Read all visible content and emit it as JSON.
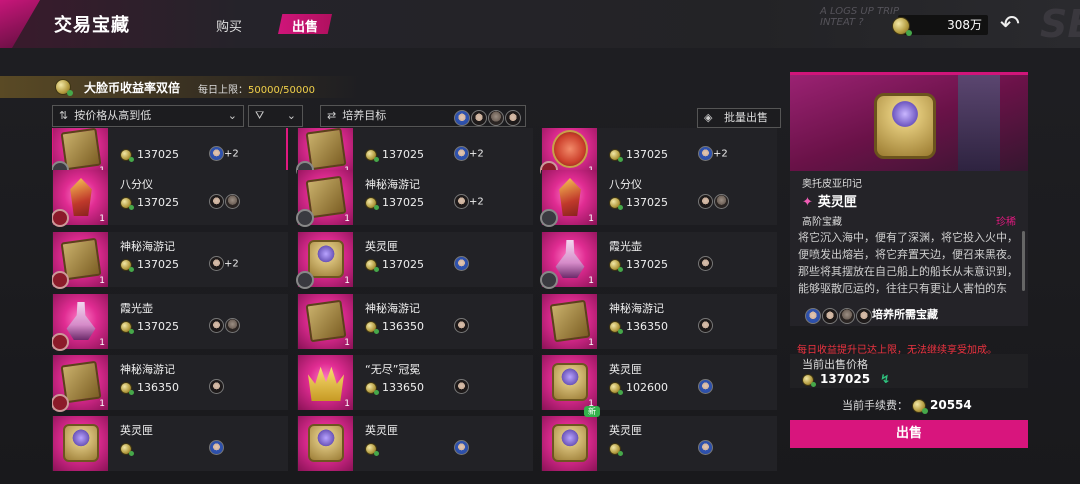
{
  "header": {
    "title": "交易宝藏",
    "tab_buy": "购买",
    "tab_sell": "出售",
    "bg_text": "A LOGS UP TRIP\nINTEAT ?",
    "currency": "308万"
  },
  "banner": {
    "title": "大脸币收益率双倍",
    "limit_label": "每日上限：",
    "limit_value": "50000/50000"
  },
  "filters": {
    "sort": "按价格从高到低",
    "train": "培养目标",
    "batch": "批量出售"
  },
  "items": [
    {
      "name": "",
      "price": "137025",
      "heads": [
        "b"
      ],
      "extra": "+2",
      "kind": "book",
      "badge": "g",
      "qty": "1",
      "selected": true
    },
    {
      "name": "",
      "price": "137025",
      "heads": [
        "b"
      ],
      "extra": "+2",
      "kind": "book",
      "badge": "g",
      "qty": "1"
    },
    {
      "name": "",
      "price": "137025",
      "heads": [
        "b"
      ],
      "extra": "+2",
      "kind": "cup",
      "badge": "r",
      "qty": "1"
    },
    {
      "name": "八分仪",
      "price": "137025",
      "heads": [
        "k",
        "a"
      ],
      "extra": "",
      "kind": "oct",
      "badge": "r",
      "qty": "1"
    },
    {
      "name": "神秘海游记",
      "price": "137025",
      "heads": [
        "k"
      ],
      "extra": "+2",
      "kind": "book",
      "badge": "g",
      "qty": "1"
    },
    {
      "name": "八分仪",
      "price": "137025",
      "heads": [
        "k",
        "a"
      ],
      "extra": "",
      "kind": "oct",
      "badge": "g",
      "qty": "1"
    },
    {
      "name": "神秘海游记",
      "price": "137025",
      "heads": [
        "k"
      ],
      "extra": "+2",
      "kind": "book",
      "badge": "r",
      "qty": "1"
    },
    {
      "name": "英灵匣",
      "price": "137025",
      "heads": [
        "b"
      ],
      "extra": "",
      "kind": "box",
      "badge": "g",
      "qty": "1"
    },
    {
      "name": "霞光壶",
      "price": "137025",
      "heads": [
        "k"
      ],
      "extra": "",
      "kind": "pot",
      "badge": "g",
      "qty": "1"
    },
    {
      "name": "霞光壶",
      "price": "137025",
      "heads": [
        "k",
        "a"
      ],
      "extra": "",
      "kind": "pot",
      "badge": "r",
      "qty": "1"
    },
    {
      "name": "神秘海游记",
      "price": "136350",
      "heads": [
        "k"
      ],
      "extra": "",
      "kind": "book",
      "badge": "",
      "qty": "1"
    },
    {
      "name": "神秘海游记",
      "price": "136350",
      "heads": [
        "k"
      ],
      "extra": "",
      "kind": "book",
      "badge": "",
      "qty": "1"
    },
    {
      "name": "神秘海游记",
      "price": "136350",
      "heads": [
        "k"
      ],
      "extra": "",
      "kind": "book",
      "badge": "r",
      "qty": "1"
    },
    {
      "name": "“无尽”冠冕",
      "price": "133650",
      "heads": [
        "k"
      ],
      "extra": "",
      "kind": "crown",
      "badge": "",
      "qty": "1"
    },
    {
      "name": "英灵匣",
      "price": "102600",
      "heads": [
        "b"
      ],
      "extra": "",
      "kind": "box",
      "badge": "",
      "qty": "1"
    },
    {
      "name": "英灵匣",
      "price": "",
      "heads": [
        "b"
      ],
      "extra": "",
      "kind": "box",
      "badge": "",
      "qty": ""
    },
    {
      "name": "英灵匣",
      "price": "",
      "heads": [
        "b"
      ],
      "extra": "",
      "kind": "box",
      "badge": "",
      "qty": ""
    },
    {
      "name": "英灵匣",
      "price": "",
      "heads": [
        "b"
      ],
      "extra": "",
      "kind": "box",
      "badge": "",
      "qty": "",
      "new": "新"
    }
  ],
  "detail": {
    "subtitle": "奥托皮亚印记",
    "name": "英灵匣",
    "category": "高阶宝藏",
    "rarity": "珍稀",
    "description": "将它沉入海中，便有了深渊，将它投入火中，便喷发出熔岩，将它弃置天边，便召来黑夜。那些将其摆放在自己船上的船长从未意识到，能够驱散厄运的，往往只有更让人害怕的东西。",
    "train_label": "培养所需宝藏"
  },
  "warning": "每日收益提升已达上限，无法继续享受加成。",
  "sale": {
    "price_label": "当前出售价格",
    "price": "137025",
    "fee_label": "当前手续费：",
    "fee": "20554",
    "sell_button": "出售"
  }
}
